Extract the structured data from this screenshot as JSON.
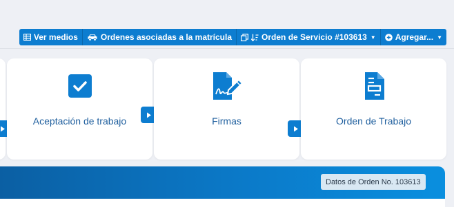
{
  "toolbar": {
    "ver_medios": "Ver medios",
    "ordenes_asociadas": "Ordenes asociadas a la matrícula",
    "orden_servicio": "Orden de Servicio #103613",
    "agregar": "Agregar..."
  },
  "steps": [
    {
      "label": "Aceptación de trabajo",
      "icon": "checkbox-icon"
    },
    {
      "label": "Firmas",
      "icon": "signature-icon"
    },
    {
      "label": "Orden de Trabajo",
      "icon": "document-icon"
    }
  ],
  "banner": {
    "badge": "Datos de Orden No. 103613"
  },
  "colors": {
    "accent": "#0d7dd0",
    "label": "#1f5f9e"
  }
}
